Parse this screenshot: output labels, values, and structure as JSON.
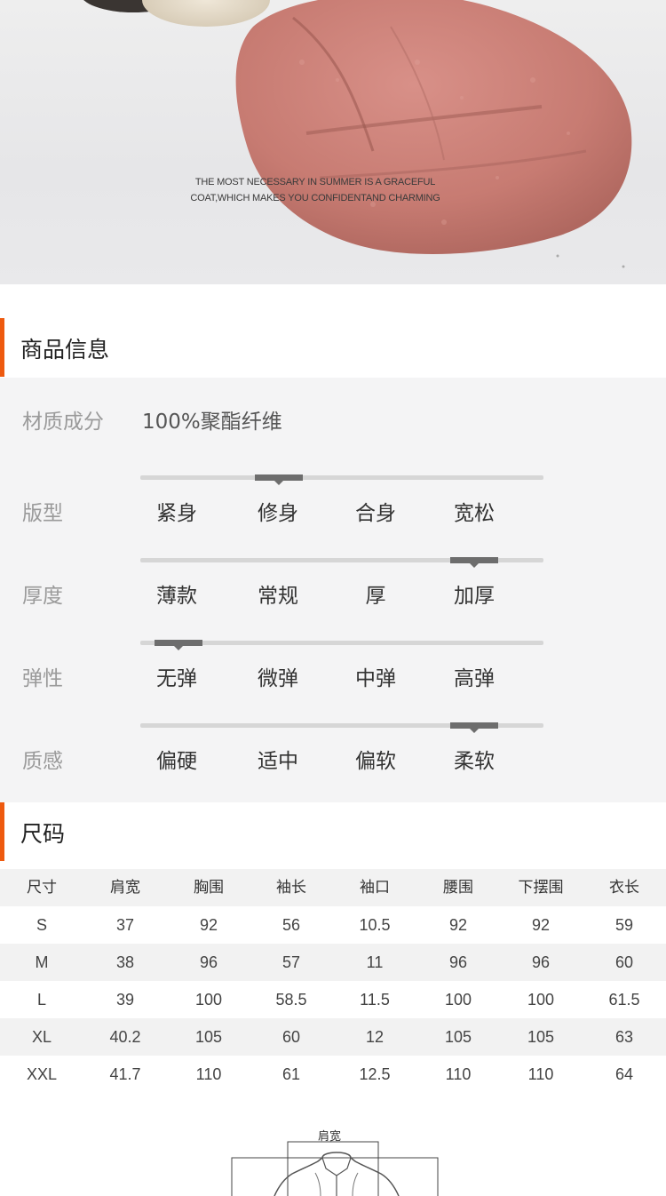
{
  "hero": {
    "caption_line1": "THE MOST NECESSARY IN SUMMER IS A GRACEFUL",
    "caption_line2": "COAT,WHICH MAKES YOU CONFIDENTAND CHARMING"
  },
  "product_info": {
    "title": "商品信息",
    "material_label": "材质成分",
    "material_value": "100%聚酯纤维",
    "scales": [
      {
        "label": "版型",
        "options": [
          "紧身",
          "修身",
          "合身",
          "宽松"
        ],
        "selected": "修身",
        "selected_index": 1
      },
      {
        "label": "厚度",
        "options": [
          "薄款",
          "常规",
          "厚",
          "加厚"
        ],
        "selected": "加厚",
        "selected_index": 3
      },
      {
        "label": "弹性",
        "options": [
          "无弹",
          "微弹",
          "中弹",
          "高弹"
        ],
        "selected": "无弹",
        "selected_index": 0
      },
      {
        "label": "质感",
        "options": [
          "偏硬",
          "适中",
          "偏软",
          "柔软"
        ],
        "selected": "柔软",
        "selected_index": 3
      }
    ]
  },
  "size_chart": {
    "title": "尺码",
    "headers": [
      "尺寸",
      "肩宽",
      "胸围",
      "袖长",
      "袖口",
      "腰围",
      "下摆围",
      "衣长"
    ],
    "rows": [
      [
        "S",
        "37",
        "92",
        "56",
        "10.5",
        "92",
        "92",
        "59"
      ],
      [
        "M",
        "38",
        "96",
        "57",
        "11",
        "96",
        "96",
        "60"
      ],
      [
        "L",
        "39",
        "100",
        "58.5",
        "11.5",
        "100",
        "100",
        "61.5"
      ],
      [
        "XL",
        "40.2",
        "105",
        "60",
        "12",
        "105",
        "105",
        "63"
      ],
      [
        "XXL",
        "41.7",
        "110",
        "61",
        "12.5",
        "110",
        "110",
        "64"
      ]
    ]
  },
  "diagram": {
    "shoulder_label": "肩宽"
  },
  "colors": {
    "accent": "#ee5a0f",
    "panel_bg": "#f4f4f5",
    "marker": "#6d6d6d",
    "fabric_pink": "#c77b72",
    "fabric_cream": "#e6dccb"
  }
}
